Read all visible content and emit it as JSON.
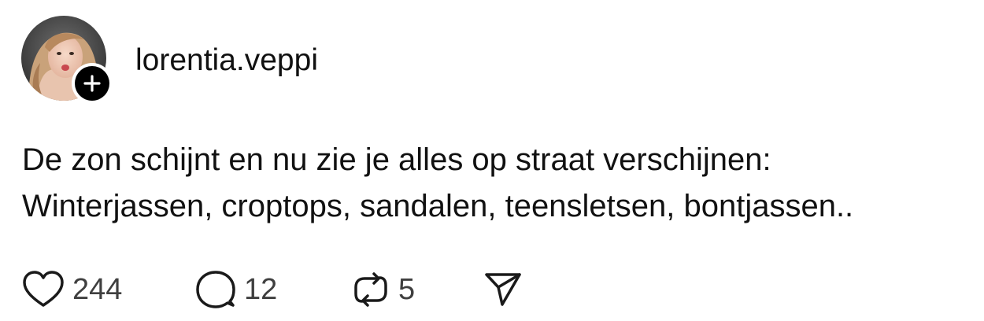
{
  "post": {
    "author": {
      "username": "lorentia.veppi"
    },
    "text_lines": [
      "De zon schijnt en nu zie je alles op straat verschijnen:",
      "Winterjassen, croptops, sandalen, teensletsen, bontjassen.."
    ],
    "actions": {
      "likes": "244",
      "replies": "12",
      "reposts": "5"
    }
  },
  "icons": {
    "follow": "plus-icon",
    "like": "heart-icon",
    "reply": "speech-bubble-icon",
    "repost": "repost-icon",
    "share": "paper-plane-icon"
  },
  "colors": {
    "text": "#111111",
    "count": "#3f3f3f",
    "badge": "#000000"
  }
}
